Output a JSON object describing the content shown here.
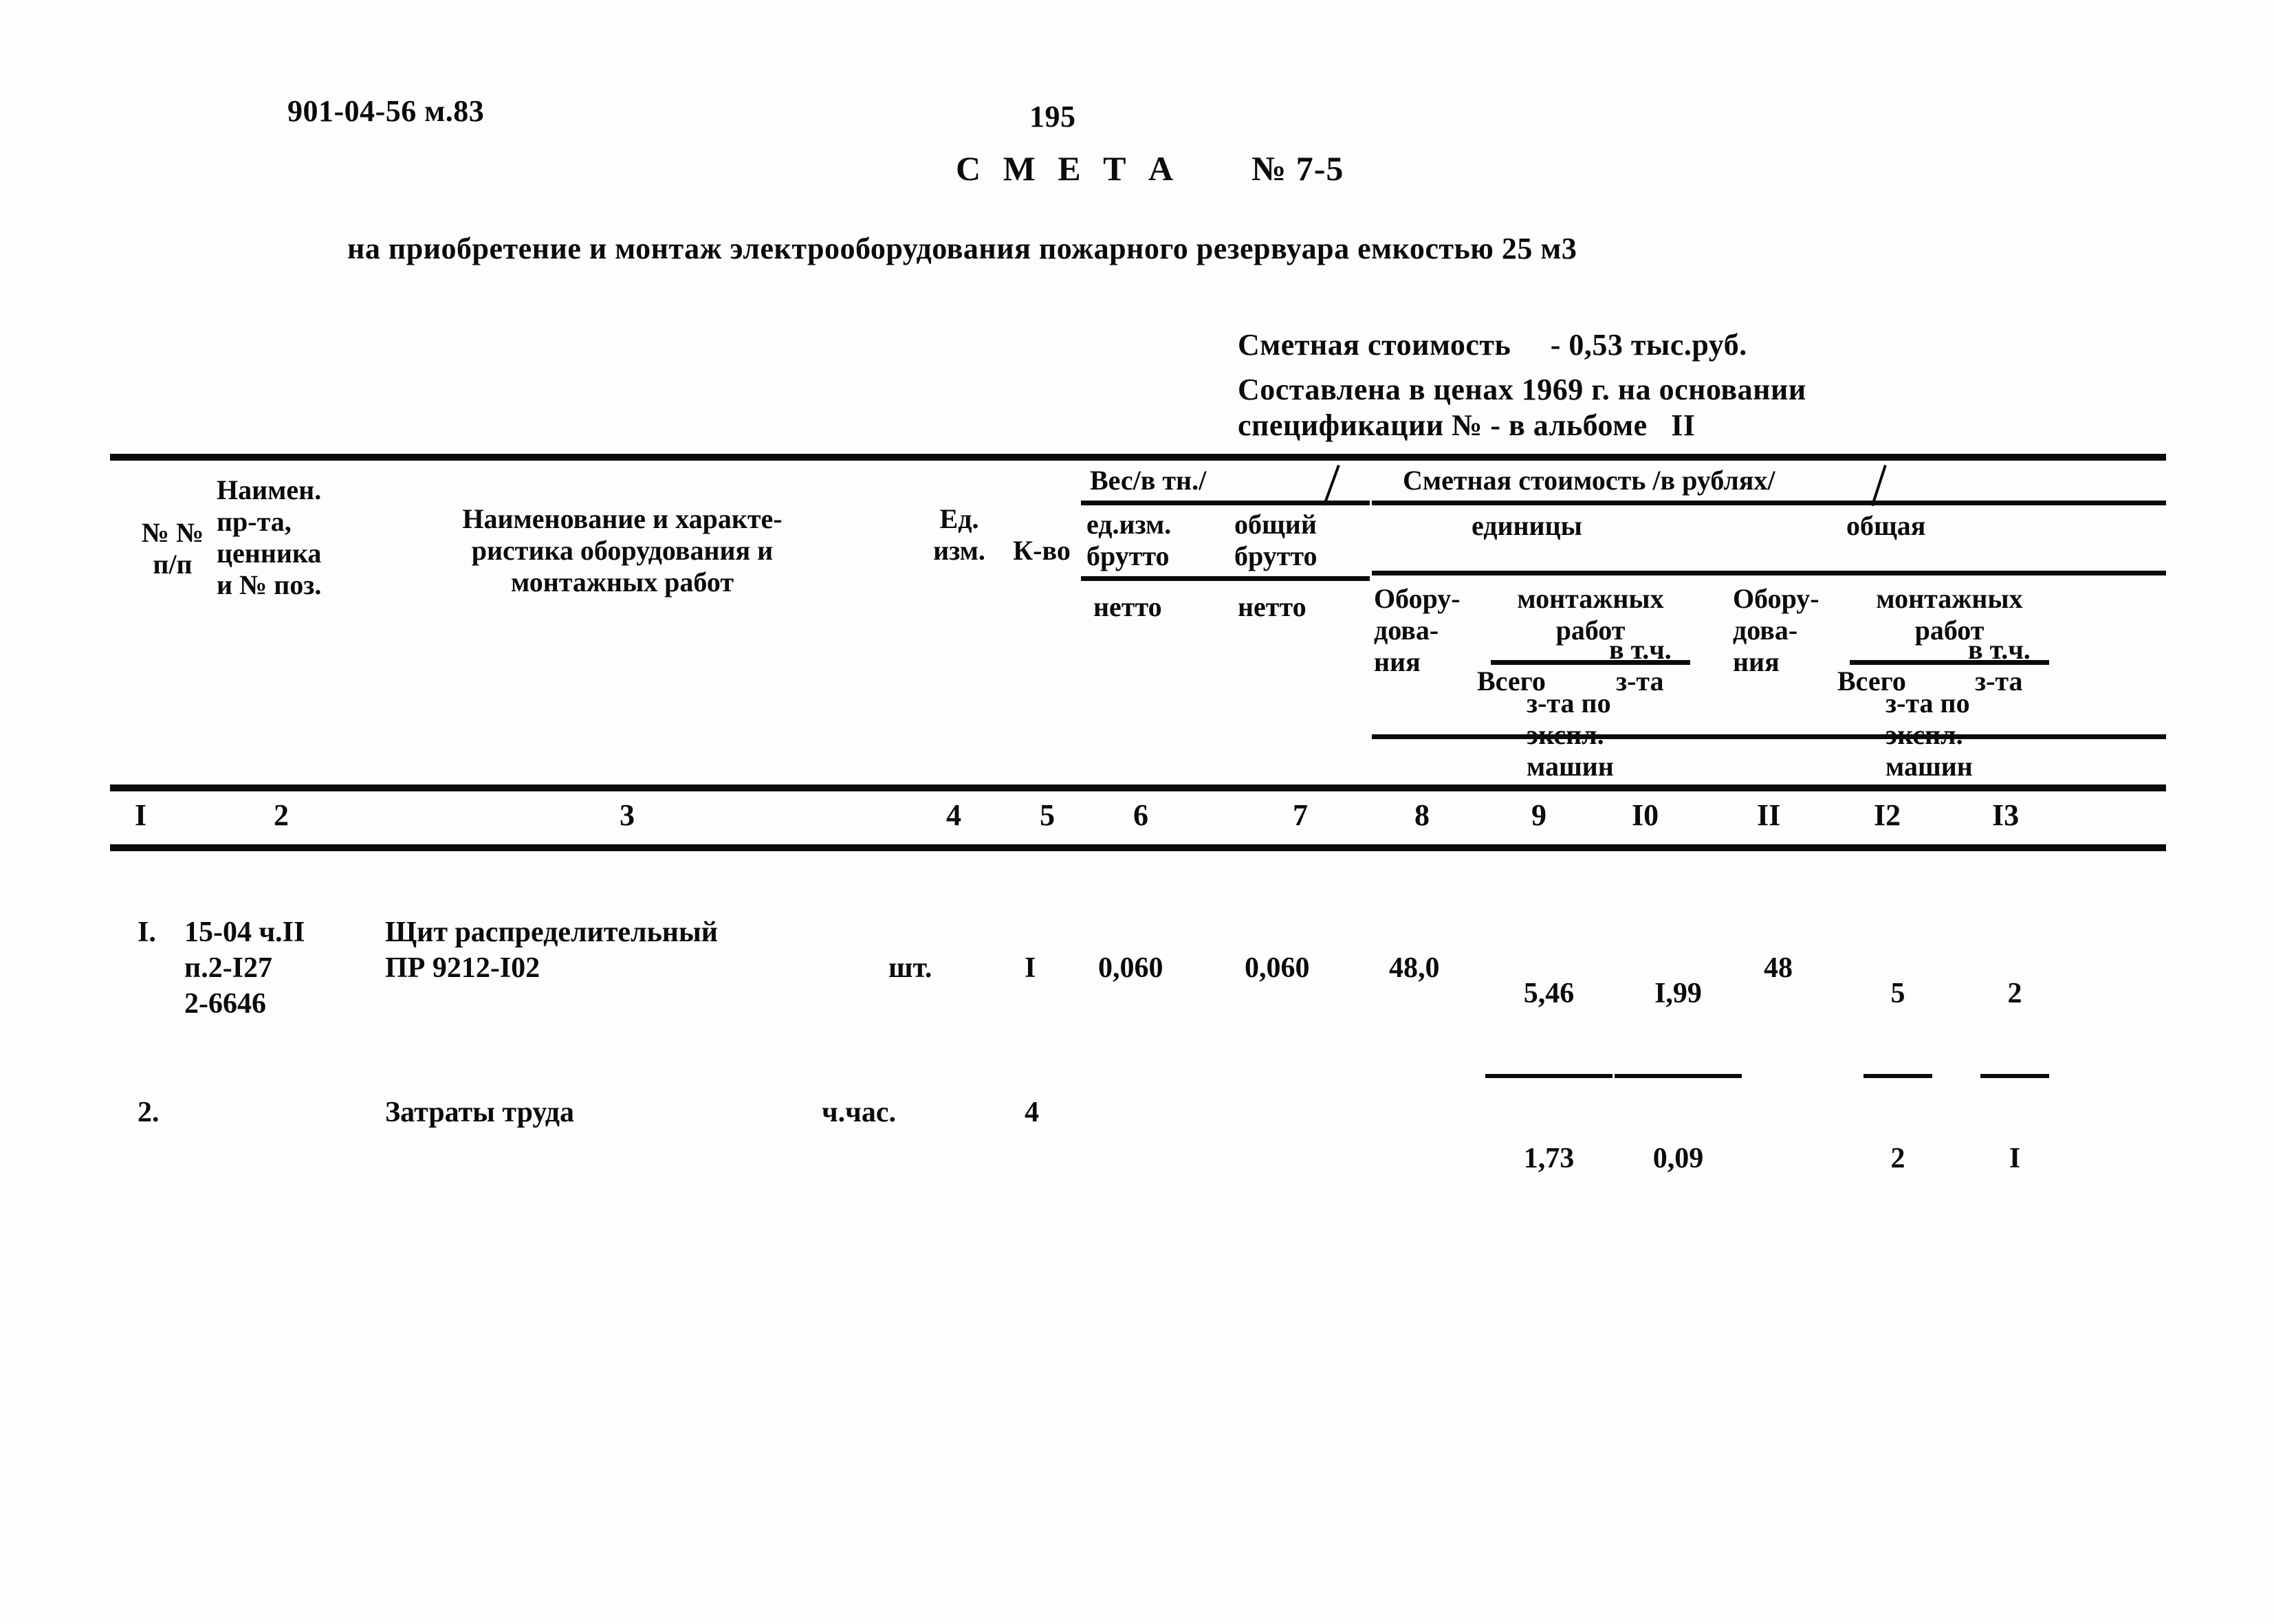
{
  "document": {
    "code": "901-04-56 м.83",
    "page_number": "195",
    "title": "С М Е Т А",
    "title_number": "№ 7-5",
    "subtitle": "на приобретение и монтаж электрооборудования пожарного резервуара емкостью 25 м3",
    "estimate_cost_line": "Сметная стоимость     - 0,53 тыс.руб.",
    "basis_line_1": "Составлена в ценах 1969 г. на основании",
    "basis_line_2": "спецификации № - в альбоме   II"
  },
  "table": {
    "header": {
      "col1": "№ №\nп/п",
      "col2": "Наимен.\nпр-та,\nценника\nи № поз.",
      "col3": "Наименование и характе-\nристика оборудования и\nмонтажных работ",
      "col4": "Ед.\nизм.",
      "col5": "К-во",
      "weight_group": "Вес/в тн./",
      "col6_top": "ед.изм.",
      "col6_bottom": "брутто",
      "col6_net": "нетто",
      "col7_top": "общий",
      "col7_bottom": "брутто",
      "col7_net": "нетто",
      "cost_group": "Сметная стоимость /в рублях/",
      "unit_group": "единицы",
      "total_group": "общая",
      "col8": "Обору-\nдова-\nния",
      "col9_10_group": "монтажных\nработ",
      "col9": "Всего",
      "col10_a": "в т.ч.",
      "col10_b": "з-та",
      "col9_10_footer": "з-та по\nэкспл.\nмашин",
      "col11": "Обору-\nдова-\nния",
      "col12_13_group": "монтажных\nработ",
      "col12": "Всего",
      "col13_a": "в т.ч.",
      "col13_b": "з-та",
      "col12_13_footer": "з-та по\nэкспл.\nмашин"
    },
    "column_numbers": [
      "I",
      "2",
      "3",
      "4",
      "5",
      "6",
      "7",
      "8",
      "9",
      "I0",
      "II",
      "I2",
      "I3"
    ],
    "rows": [
      {
        "num": "I.",
        "price_ref": "15-04 ч.II\nп.2-I27\n2-6646",
        "name": "Щит распределительный\nПР 9212-I02",
        "unit": "шт.",
        "qty": "I",
        "weight_unit": "0,060",
        "weight_total": "0,060",
        "cost_equipment_unit": "48,0",
        "install_unit_total": "5,46",
        "install_unit_wages": "1,73",
        "install_unit_mach_num": "I,99",
        "install_unit_mach_den": "0,09",
        "cost_equipment_total": "48",
        "install_total_total": "5",
        "install_total_wages": "2",
        "install_total_mach_num": "2",
        "install_total_mach_den": "I"
      },
      {
        "num": "2.",
        "price_ref": "",
        "name": "Затраты труда",
        "unit": "ч.час.",
        "qty": "4",
        "weight_unit": "",
        "weight_total": "",
        "cost_equipment_unit": "",
        "install_unit_total": "",
        "install_unit_wages": "",
        "install_unit_mach_num": "",
        "install_unit_mach_den": "",
        "cost_equipment_total": "",
        "install_total_total": "",
        "install_total_wages": "",
        "install_total_mach_num": "",
        "install_total_mach_den": ""
      }
    ]
  }
}
